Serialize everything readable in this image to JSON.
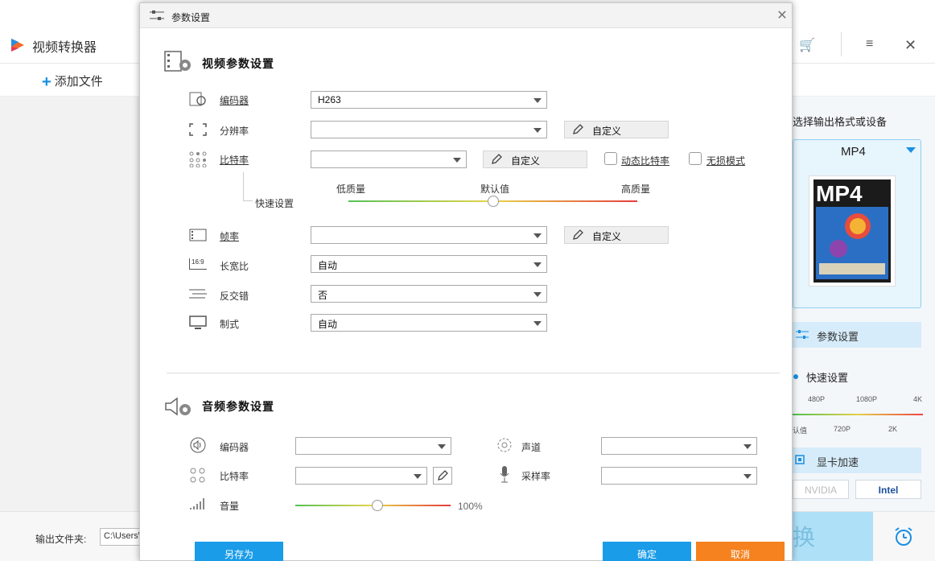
{
  "background_app": {
    "title": "视频转换器",
    "add_file_label": "添加文件",
    "output_folder_label": "输出文件夹:",
    "output_path": "C:\\Users\\",
    "convert_char": "换",
    "right_panel": {
      "prompt": "选择输出格式或设备",
      "format": "MP4",
      "thumb_label": "MP4",
      "params_button": "参数设置",
      "quick_settings": "快速设置",
      "quality_labels_top": [
        "480P",
        "1080P",
        "4K"
      ],
      "quality_labels_bottom": [
        "认值",
        "720P",
        "2K"
      ],
      "gpu_accel": "显卡加速",
      "gpu_nvidia": "NVIDIA",
      "gpu_intel": "Intel"
    }
  },
  "dialog": {
    "title": "参数设置",
    "video": {
      "section_title": "视频参数设置",
      "encoder": {
        "label": "编码器",
        "value": "H263"
      },
      "resolution": {
        "label": "分辨率",
        "value": "",
        "custom": "自定义"
      },
      "bitrate": {
        "label": "比特率",
        "value": "",
        "custom": "自定义",
        "vbr": "动态比特率",
        "lossless": "无损模式"
      },
      "quick": {
        "label": "快速设置",
        "low": "低质量",
        "default": "默认值",
        "high": "高质量",
        "level": 0.5
      },
      "framerate": {
        "label": "帧率",
        "value": "",
        "custom": "自定义"
      },
      "aspect": {
        "label": "长宽比",
        "value": "自动",
        "icon_text": "16:9"
      },
      "deinterlace": {
        "label": "反交错",
        "value": "否"
      },
      "standard": {
        "label": "制式",
        "value": "自动"
      }
    },
    "audio": {
      "section_title": "音频参数设置",
      "encoder": {
        "label": "编码器",
        "value": ""
      },
      "channel": {
        "label": "声道",
        "value": ""
      },
      "bitrate": {
        "label": "比特率",
        "value": ""
      },
      "samplerate": {
        "label": "采样率",
        "value": ""
      },
      "volume": {
        "label": "音量",
        "value": "100%",
        "level": 0.53
      }
    },
    "footer": {
      "save_as": "另存为",
      "ok": "确定",
      "cancel": "取消"
    },
    "colors": {
      "accent": "#1a9ce8",
      "cancel": "#f5821f"
    }
  }
}
